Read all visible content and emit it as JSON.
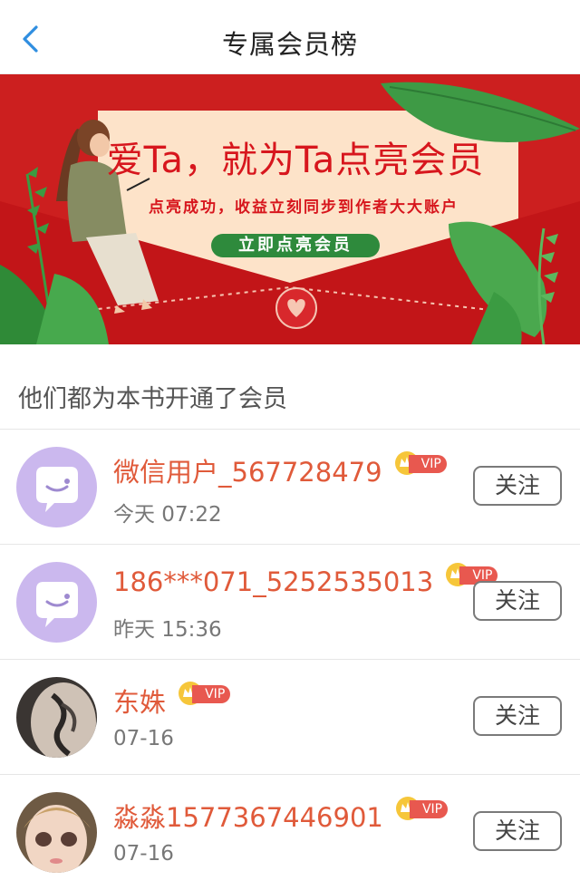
{
  "header": {
    "title": "专属会员榜"
  },
  "banner": {
    "headline": "爱Ta，就为Ta点亮会员",
    "subline": "点亮成功，收益立刻同步到作者大大账户",
    "button_label": "立即点亮会员"
  },
  "section": {
    "title": "他们都为本书开通了会员"
  },
  "members": [
    {
      "name": "微信用户_567728479",
      "badge": "VIP",
      "time": "今天 07:22",
      "follow": "关注",
      "avatar": "wechat-default"
    },
    {
      "name": "186***071_5252535013",
      "badge": "VIP",
      "time": "昨天 15:36",
      "follow": "关注",
      "avatar": "wechat-default"
    },
    {
      "name": "东姝",
      "badge": "VIP",
      "time": "07-16",
      "follow": "关注",
      "avatar": "photo"
    },
    {
      "name": "淼淼1577367446901",
      "badge": "VIP",
      "time": "07-16",
      "follow": "关注",
      "avatar": "photo"
    }
  ],
  "colors": {
    "accent": "#e05a3a",
    "banner_red": "#d7161d",
    "back_arrow": "#2f8ee0",
    "vip_tag": "#e8584f"
  }
}
